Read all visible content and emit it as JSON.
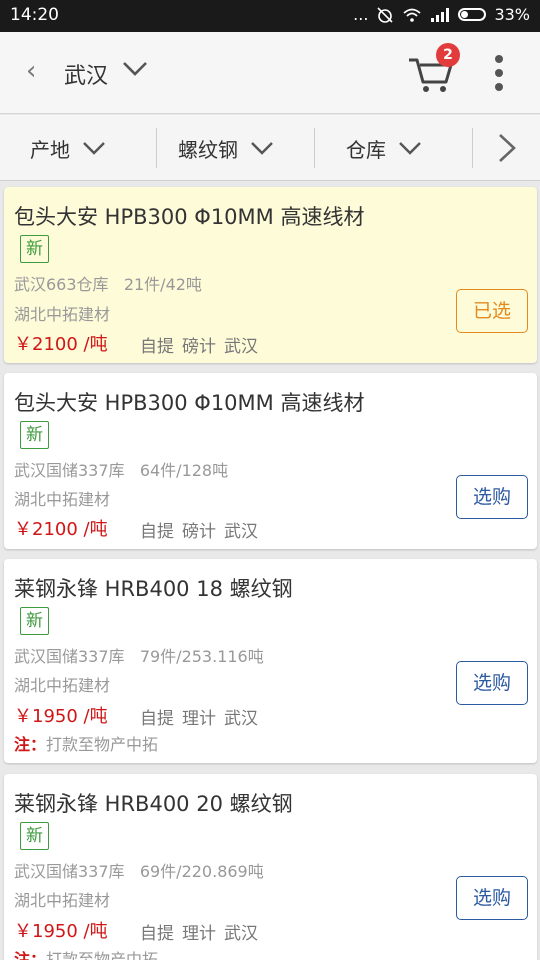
{
  "status": {
    "time": "14:20",
    "dots": "...",
    "battery": "33%"
  },
  "header": {
    "back_icon": "‹",
    "city": "武汉",
    "cart_count": "2"
  },
  "filters": [
    "产地",
    "螺纹钢",
    "仓库"
  ],
  "items": [
    {
      "title": "包头大安 HPB300 Φ10MM 高速线材",
      "tag": "新",
      "warehouse": "武汉663仓库",
      "qty": "21件/42吨",
      "seller": "湖北中拓建材",
      "price": "￥2100 /吨",
      "pickup": "自提",
      "measure": "磅计",
      "city": "武汉",
      "button": "已选"
    },
    {
      "title": "包头大安 HPB300 Φ10MM 高速线材",
      "tag": "新",
      "warehouse": "武汉国储337库",
      "qty": "64件/128吨",
      "seller": "湖北中拓建材",
      "price": "￥2100 /吨",
      "pickup": "自提",
      "measure": "磅计",
      "city": "武汉",
      "button": "选购"
    },
    {
      "title": "莱钢永锋 HRB400 18 螺纹钢",
      "tag": "新",
      "warehouse": "武汉国储337库",
      "qty": "79件/253.116吨",
      "seller": "湖北中拓建材",
      "price": "￥1950 /吨",
      "pickup": "自提",
      "measure": "理计",
      "city": "武汉",
      "note_label": "注：",
      "note": "打款至物产中拓",
      "button": "选购"
    },
    {
      "title": "莱钢永锋 HRB400 20 螺纹钢",
      "tag": "新",
      "warehouse": "武汉国储337库",
      "qty": "69件/220.869吨",
      "seller": "湖北中拓建材",
      "price": "￥1950 /吨",
      "pickup": "自提",
      "measure": "理计",
      "city": "武汉",
      "note_label": "注：",
      "note": "打款至物产中拓",
      "button": "选购"
    }
  ],
  "colors": {
    "accent_blue": "#2c5aa0",
    "price_red": "#d01616",
    "new_green": "#3e9b3e",
    "selected_orange": "#e3891d",
    "selected_bg": "#fefbd9",
    "badge_red": "#e23b3b"
  }
}
